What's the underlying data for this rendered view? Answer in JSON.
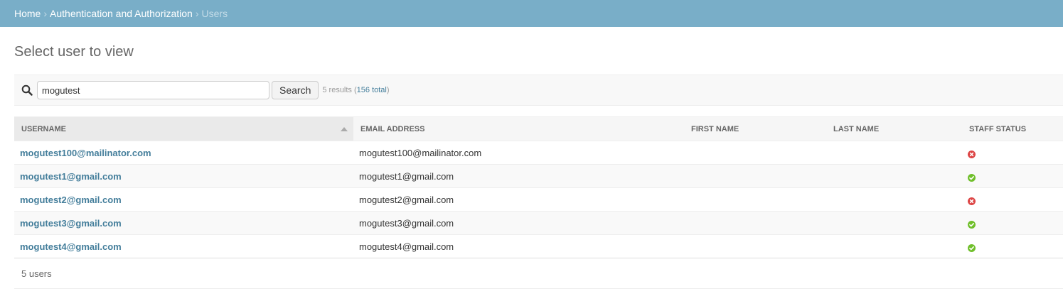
{
  "breadcrumbs": {
    "home": "Home",
    "sep1": "›",
    "section": "Authentication and Authorization",
    "sep2": "›",
    "current": "Users"
  },
  "page_title": "Select user to view",
  "search": {
    "icon": "search-icon",
    "value": "mogutest",
    "button_label": "Search",
    "result_prefix": "5 results (",
    "total_link": "156 total",
    "result_suffix": ")"
  },
  "table": {
    "columns": [
      "Username",
      "Email address",
      "First name",
      "Last name",
      "Staff status"
    ],
    "sorted_column": "Username",
    "rows": [
      {
        "username": "mogutest100@mailinator.com",
        "email": "mogutest100@mailinator.com",
        "first_name": "",
        "last_name": "",
        "staff_status": "no",
        "status_icon": "x-circle-icon",
        "status_color": "#dd4646"
      },
      {
        "username": "mogutest1@gmail.com",
        "email": "mogutest1@gmail.com",
        "first_name": "",
        "last_name": "",
        "staff_status": "yes",
        "status_icon": "check-circle-icon",
        "status_color": "#70bf2b"
      },
      {
        "username": "mogutest2@gmail.com",
        "email": "mogutest2@gmail.com",
        "first_name": "",
        "last_name": "",
        "staff_status": "no",
        "status_icon": "x-circle-icon",
        "status_color": "#dd4646"
      },
      {
        "username": "mogutest3@gmail.com",
        "email": "mogutest3@gmail.com",
        "first_name": "",
        "last_name": "",
        "staff_status": "yes",
        "status_icon": "check-circle-icon",
        "status_color": "#70bf2b"
      },
      {
        "username": "mogutest4@gmail.com",
        "email": "mogutest4@gmail.com",
        "first_name": "",
        "last_name": "",
        "staff_status": "yes",
        "status_icon": "check-circle-icon",
        "status_color": "#70bf2b"
      }
    ]
  },
  "paginator": "5 users",
  "colors": {
    "header_bar": "#79aec8",
    "link": "#447e9b",
    "yes": "#70bf2b",
    "no": "#dd4646"
  }
}
